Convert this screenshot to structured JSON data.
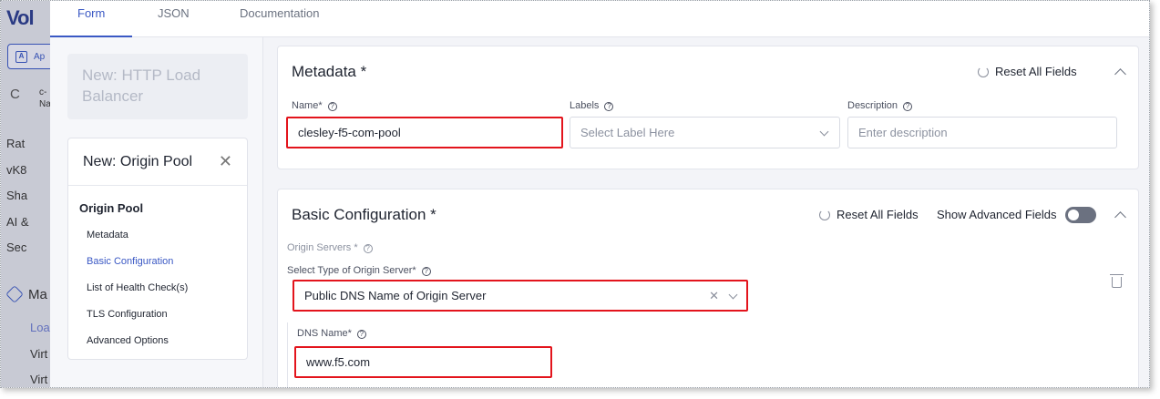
{
  "appnav": {
    "logo": "Vol",
    "workspace_label": "Ap",
    "namespace_initial": "C",
    "namespace_lines": [
      "c-",
      "Na"
    ],
    "items": [
      "Rat",
      "vK8",
      "Sha",
      "AI &",
      "Sec"
    ],
    "section": "Ma",
    "links": [
      "Loa",
      "Virt",
      "Virt"
    ]
  },
  "tabs": [
    "Form",
    "JSON",
    "Documentation"
  ],
  "leftcol": {
    "parent_title": "New: HTTP Load Balancer",
    "nav_title": "New: Origin Pool",
    "group": "Origin Pool",
    "links": [
      "Metadata",
      "Basic Configuration",
      "List of Health Check(s)",
      "TLS Configuration",
      "Advanced Options"
    ]
  },
  "metadata": {
    "title": "Metadata *",
    "reset_label": "Reset All Fields",
    "name_label": "Name*",
    "name_value": "clesley-f5-com-pool",
    "labels_label": "Labels",
    "labels_placeholder": "Select Label Here",
    "description_label": "Description",
    "description_placeholder": "Enter description"
  },
  "basic": {
    "title": "Basic Configuration *",
    "reset_label": "Reset All Fields",
    "advanced_label": "Show Advanced Fields",
    "origin_servers_label": "Origin Servers *",
    "type_label": "Select Type of Origin Server*",
    "type_value": "Public DNS Name of Origin Server",
    "dns_label": "DNS Name*",
    "dns_value": "www.f5.com"
  }
}
